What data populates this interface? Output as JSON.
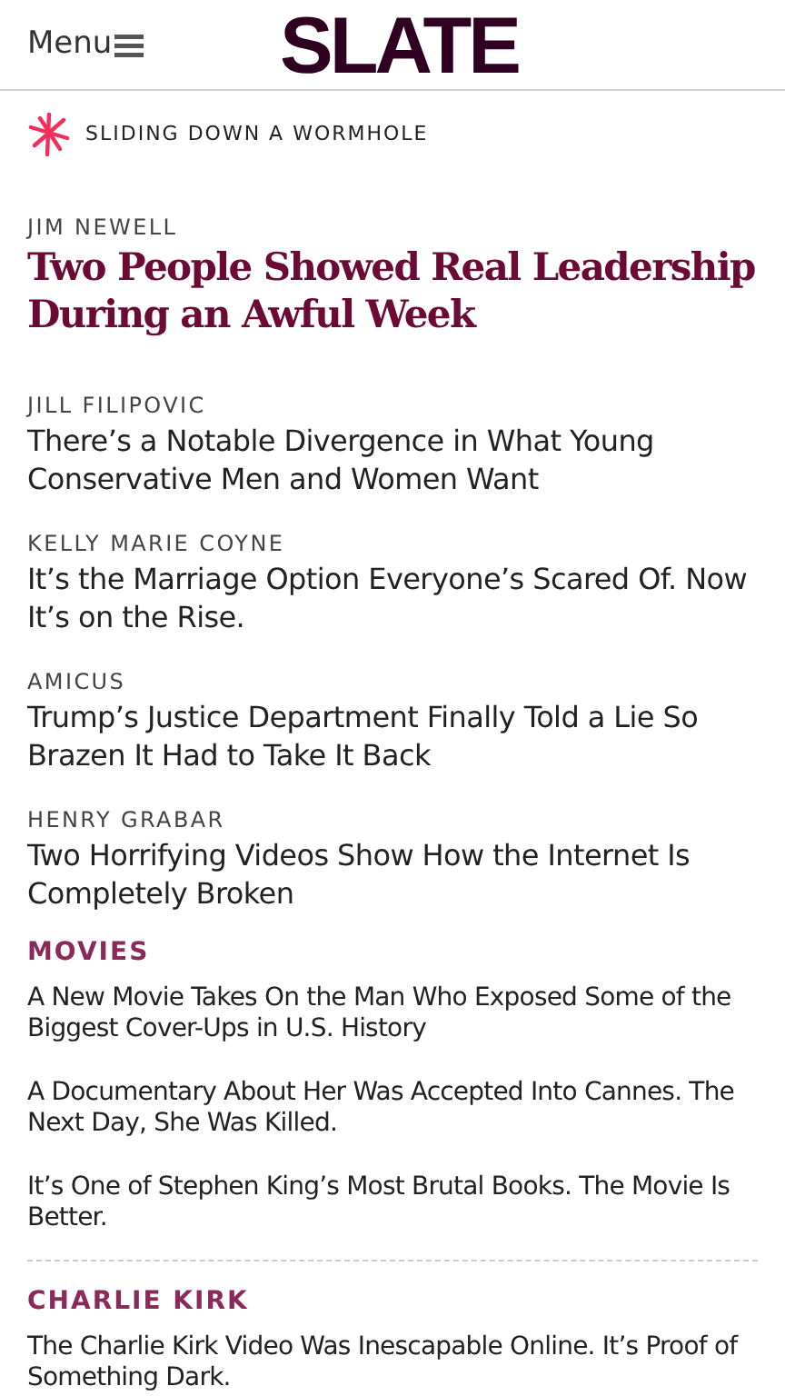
{
  "header": {
    "menu_label": "Menu",
    "logo": "SLATE"
  },
  "section": {
    "label": "SLIDING DOWN A WORMHOLE"
  },
  "lead": {
    "byline": "JIM NEWELL",
    "headline": "Two People Showed Real Leadership During an Awful Week"
  },
  "stories": [
    {
      "byline": "JILL FILIPOVIC",
      "headline": "There’s a Notable Divergence in What Young Conservative Men and Women Want"
    },
    {
      "byline": "KELLY MARIE COYNE",
      "headline": "It’s the Marriage Option Everyone’s Scared Of. Now It’s on the Rise."
    },
    {
      "byline": "AMICUS",
      "headline": "Trump’s Justice Department Finally Told a Lie So Brazen It Had to Take It Back"
    },
    {
      "byline": "HENRY GRABAR",
      "headline": "Two Horrifying Videos Show How the Internet Is Completely Broken"
    }
  ],
  "topics": [
    {
      "title": "MOVIES",
      "headlines": [
        "A New Movie Takes On the Man Who Exposed Some of the Biggest Cover-Ups in U.S. History",
        "A Documentary About Her Was Accepted Into Cannes. The Next Day, She Was Killed.",
        "It’s One of Stephen King’s Most Brutal Books. The Movie Is Better."
      ]
    },
    {
      "title": "CHARLIE KIRK",
      "headlines": [
        "The Charlie Kirk Video Was Inescapable Online. It’s Proof of Something Dark."
      ]
    }
  ]
}
